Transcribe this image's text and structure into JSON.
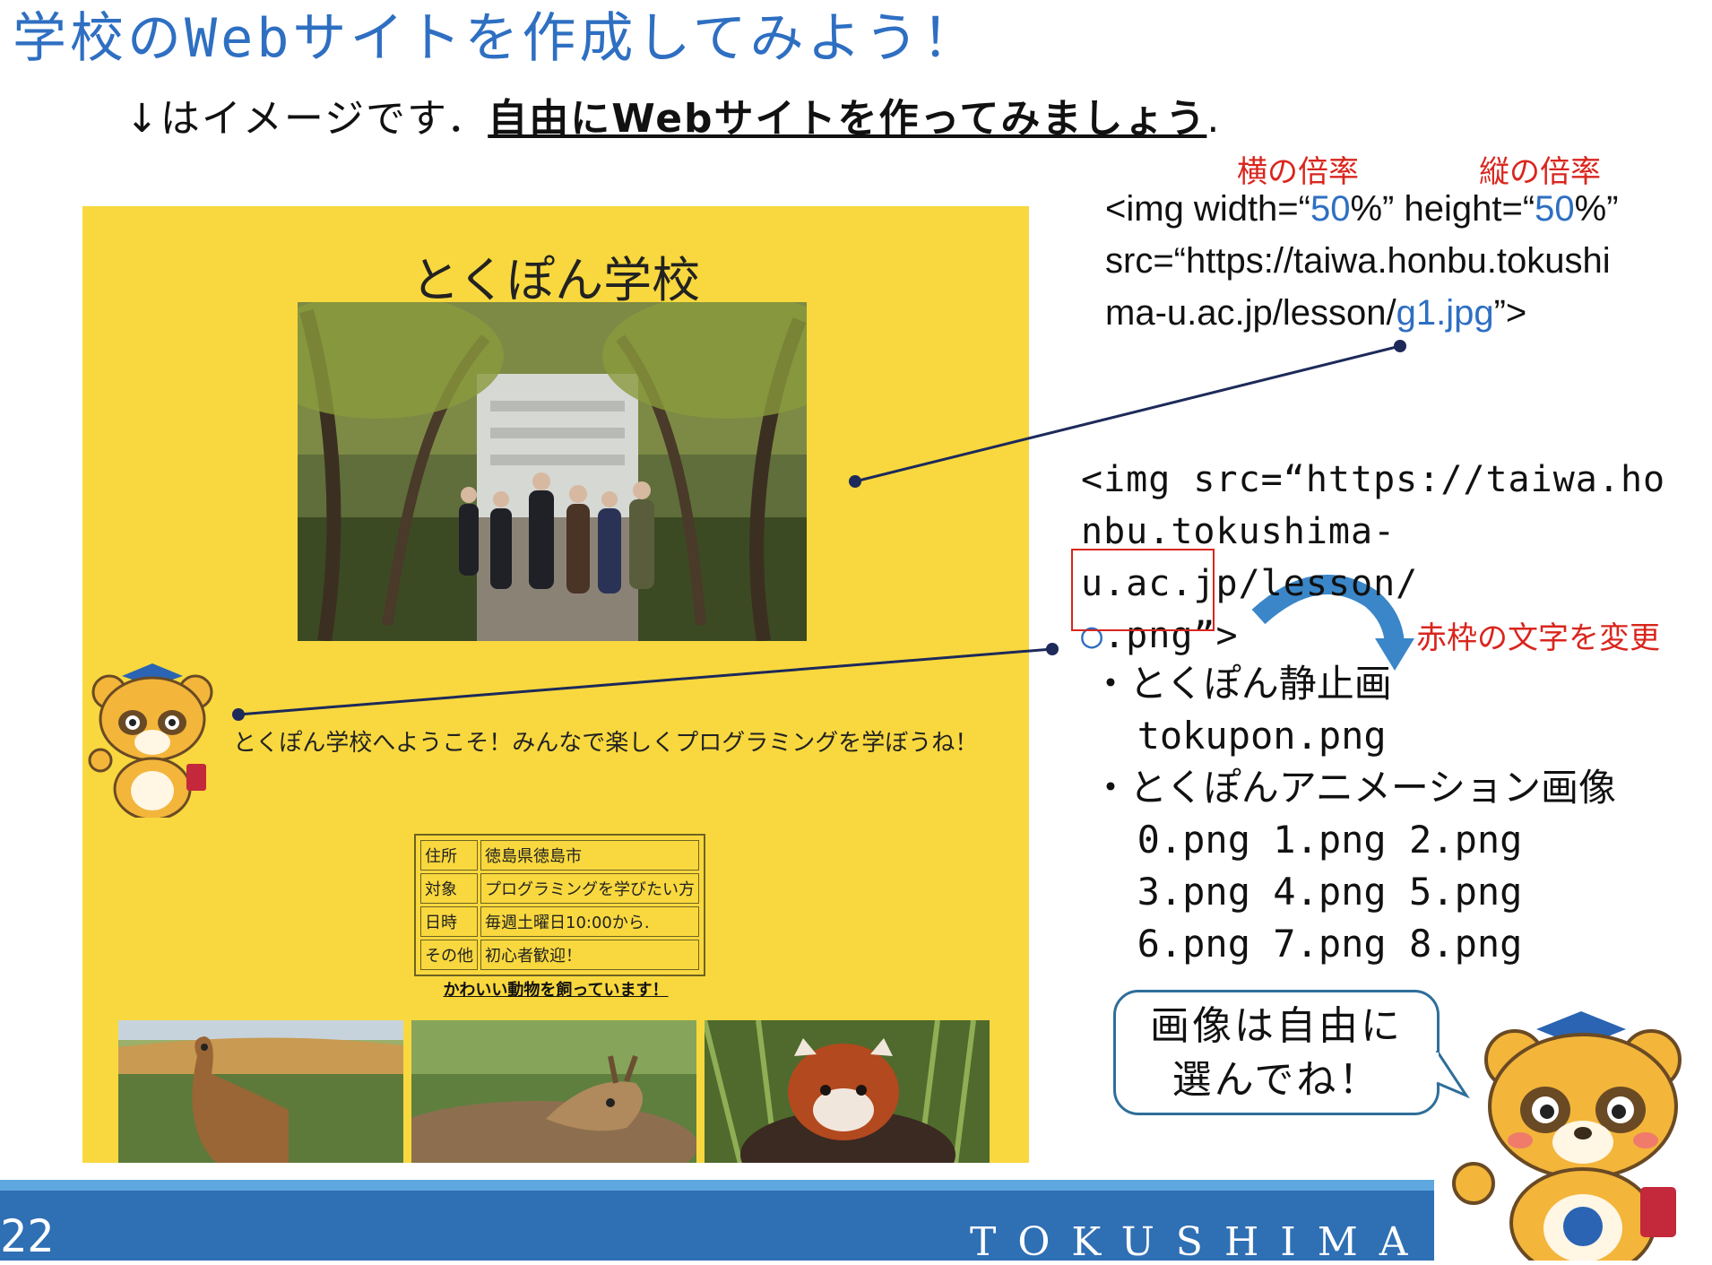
{
  "slide": {
    "title": "学校のWebサイトを作成してみよう！",
    "subtitle_lead": "↓はイメージです．",
    "subtitle_emph": "自由にWebサイトを作ってみましょう",
    "subtitle_end": "."
  },
  "mock_site": {
    "title": "とくぽん学校",
    "welcome": "とくぽん学校へようこそ！みんなで楽しくプログラミングを学ぼうね！",
    "info_rows": [
      {
        "label": "住所",
        "value": "徳島県徳島市"
      },
      {
        "label": "対象",
        "value": "プログラミングを学びたい方"
      },
      {
        "label": "日時",
        "value": "毎週土曜日10:00から."
      },
      {
        "label": "その他",
        "value": "初心者歓迎！"
      }
    ],
    "animals_caption": "かわいい動物を飼っています！"
  },
  "code1": {
    "label_width": "横の倍率",
    "label_height": "縦の倍率",
    "l1_a": "<img width=“",
    "l1_w": "50",
    "l1_b": "%” height=“",
    "l1_h": "50",
    "l1_c": "%”",
    "l2": "src=“https://taiwa.honbu.tokushi",
    "l3_a": "ma-u.ac.jp/lesson/",
    "l3_file": "g1.jpg",
    "l3_b": "”>"
  },
  "code2": {
    "l1": "<img src=“https://taiwa.ho",
    "l2": "nbu.tokushima-u.ac.jp/lesson/",
    "l3_circle": "○",
    "l3_ext": ".png",
    "l3_end": "”>",
    "change_note": "赤枠の文字を変更"
  },
  "image_list": {
    "still_head": "・とくぽん静止画",
    "still_file": "  tokupon.png",
    "anim_head": "・とくぽんアニメーション画像",
    "row1": "  0.png 1.png 2.png",
    "row2": "  3.png 4.png 5.png",
    "row3": "  6.png 7.png 8.png"
  },
  "bubble": {
    "line1": "画像は自由に",
    "line2": "選んでね！"
  },
  "footer": {
    "page_number": "22",
    "org": "TOKUSHIMA UNI"
  },
  "colors": {
    "title_blue": "#2e6fc2",
    "site_yellow": "#f8d83e",
    "annotation_red": "#d9251d",
    "footer_blue": "#2f6fb4"
  }
}
